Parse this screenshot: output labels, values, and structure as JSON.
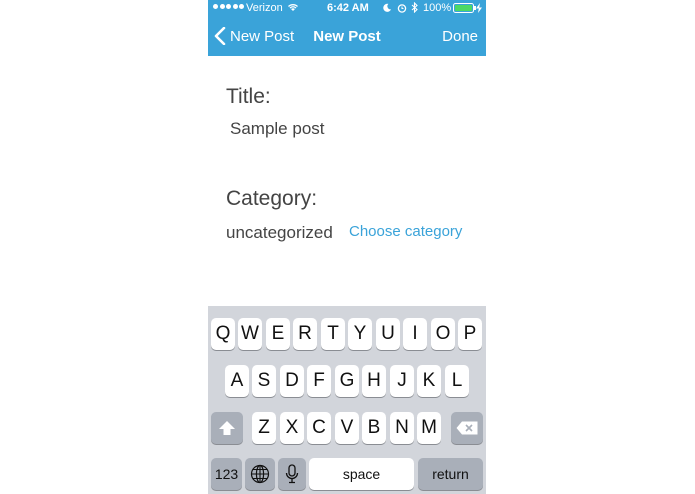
{
  "status_bar": {
    "carrier": "Verizon",
    "time": "6:42 AM",
    "battery": "100%"
  },
  "nav": {
    "back_label": "New Post",
    "title": "New Post",
    "done_label": "Done"
  },
  "form": {
    "title_label": "Title:",
    "title_value": "Sample post",
    "category_label": "Category:",
    "category_value": "uncategorized",
    "choose_category_label": "Choose category"
  },
  "keyboard": {
    "row1": [
      "Q",
      "W",
      "E",
      "R",
      "T",
      "Y",
      "U",
      "I",
      "O",
      "P"
    ],
    "row2": [
      "A",
      "S",
      "D",
      "F",
      "G",
      "H",
      "J",
      "K",
      "L"
    ],
    "row3": [
      "Z",
      "X",
      "C",
      "V",
      "B",
      "N",
      "M"
    ],
    "numbers_label": "123",
    "space_label": "space",
    "return_label": "return"
  },
  "colors": {
    "accent": "#3aa3d9",
    "keyboard_bg": "#d2d5db",
    "key_dark": "#a9afb9"
  }
}
